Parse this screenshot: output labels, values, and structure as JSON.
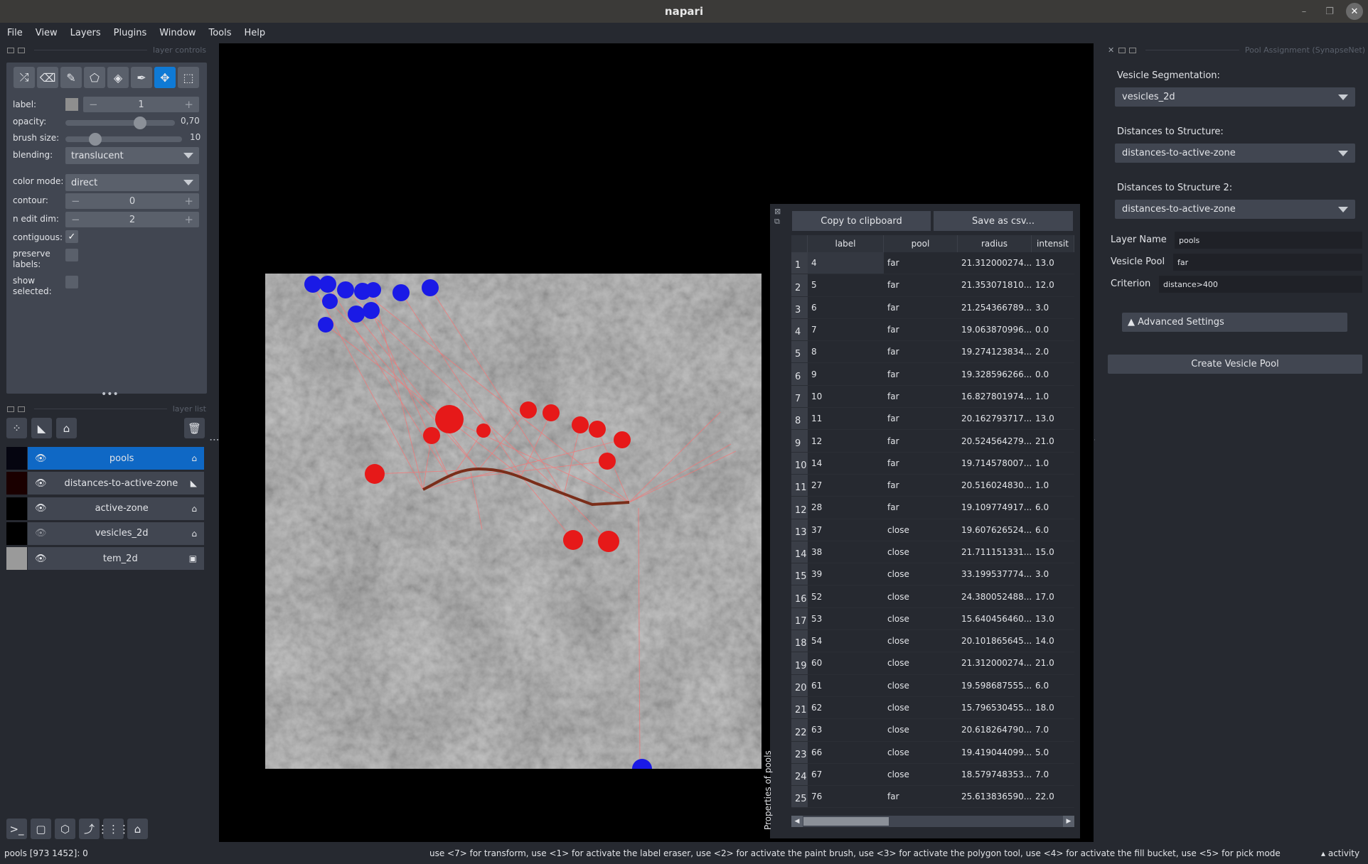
{
  "window": {
    "title": "napari"
  },
  "menu": [
    "File",
    "View",
    "Layers",
    "Plugins",
    "Window",
    "Tools",
    "Help"
  ],
  "layer_controls": {
    "header": "layer controls",
    "tools": [
      "shuffle-colors",
      "erase",
      "paint",
      "polygon",
      "fill",
      "pick",
      "pan-zoom",
      "transform"
    ],
    "active_tool": "pan-zoom",
    "label_label": "label:",
    "label_value": "1",
    "opacity_label": "opacity:",
    "opacity_value": "0,70",
    "opacity_fraction": 0.7,
    "brush_label": "brush size:",
    "brush_value": "10",
    "blending_label": "blending:",
    "blending_value": "translucent",
    "color_mode_label": "color mode:",
    "color_mode_value": "direct",
    "contour_label": "contour:",
    "contour_value": "0",
    "n_edit_label": "n edit dim:",
    "n_edit_value": "2",
    "contiguous_label": "contiguous:",
    "contiguous_checked": true,
    "preserve_label": "preserve labels:",
    "preserve_checked": false,
    "show_selected_label": "show selected:",
    "show_selected_checked": false
  },
  "layer_list": {
    "header": "layer list",
    "layers": [
      {
        "name": "pools",
        "visible": true,
        "type": "labels",
        "selected": true
      },
      {
        "name": "distances-to-active-zone",
        "visible": true,
        "type": "shapes",
        "selected": false
      },
      {
        "name": "active-zone",
        "visible": true,
        "type": "labels",
        "selected": false
      },
      {
        "name": "vesicles_2d",
        "visible": false,
        "type": "labels",
        "selected": false
      },
      {
        "name": "tem_2d",
        "visible": true,
        "type": "image",
        "selected": false
      }
    ]
  },
  "status": {
    "cursor": "pools [973 1452]: 0",
    "help": "use <7> for transform, use <1> for activate the label eraser, use <2> for activate the paint brush, use <3> for activate the polygon tool, use <4> for activate the fill bucket, use <5> for pick mode",
    "activity": "activity"
  },
  "table": {
    "dock_title": "Properties of pools",
    "copy_button": "Copy to clipboard",
    "save_button": "Save as csv...",
    "columns": [
      "label",
      "pool",
      "radius",
      "intensit"
    ],
    "rows": [
      [
        "4",
        "far",
        "21.312000274...",
        "13.0"
      ],
      [
        "5",
        "far",
        "21.353071810...",
        "12.0"
      ],
      [
        "6",
        "far",
        "21.254366789...",
        "3.0"
      ],
      [
        "7",
        "far",
        "19.063870996...",
        "0.0"
      ],
      [
        "8",
        "far",
        "19.274123834...",
        "2.0"
      ],
      [
        "9",
        "far",
        "19.328596266...",
        "0.0"
      ],
      [
        "10",
        "far",
        "16.827801974...",
        "1.0"
      ],
      [
        "11",
        "far",
        "20.162793717...",
        "13.0"
      ],
      [
        "12",
        "far",
        "20.524564279...",
        "21.0"
      ],
      [
        "14",
        "far",
        "19.714578007...",
        "1.0"
      ],
      [
        "27",
        "far",
        "20.516024830...",
        "1.0"
      ],
      [
        "28",
        "far",
        "19.109774917...",
        "6.0"
      ],
      [
        "37",
        "close",
        "19.607626524...",
        "6.0"
      ],
      [
        "38",
        "close",
        "21.711151331...",
        "15.0"
      ],
      [
        "39",
        "close",
        "33.199537774...",
        "3.0"
      ],
      [
        "52",
        "close",
        "24.380052488...",
        "17.0"
      ],
      [
        "53",
        "close",
        "15.640456460...",
        "13.0"
      ],
      [
        "54",
        "close",
        "20.101865645...",
        "14.0"
      ],
      [
        "60",
        "close",
        "21.312000274...",
        "21.0"
      ],
      [
        "61",
        "close",
        "19.598687555...",
        "6.0"
      ],
      [
        "62",
        "close",
        "15.796530455...",
        "18.0"
      ],
      [
        "63",
        "close",
        "20.618264790...",
        "7.0"
      ],
      [
        "66",
        "close",
        "19.419044099...",
        "5.0"
      ],
      [
        "67",
        "close",
        "18.579748353...",
        "7.0"
      ],
      [
        "76",
        "far",
        "25.613836590...",
        "22.0"
      ]
    ]
  },
  "pool_widget": {
    "title": "Pool Assignment (SynapseNet)",
    "seg_label": "Vesicle Segmentation:",
    "seg_value": "vesicles_2d",
    "dist_label": "Distances to Structure:",
    "dist_value": "distances-to-active-zone",
    "dist2_label": "Distances to Structure 2:",
    "dist2_value": "distances-to-active-zone",
    "layer_name_label": "Layer Name",
    "layer_name_value": "pools",
    "pool_label": "Vesicle Pool",
    "pool_value": "far",
    "criterion_label": "Criterion",
    "criterion_value": "distance>400",
    "advanced_label": "▲ Advanced Settings",
    "create_button": "Create Vesicle Pool"
  },
  "colors": {
    "accent": "#0f7ad5",
    "far_vesicle": "#1a1ae6",
    "close_vesicle": "#e61919",
    "active_zone": "#7a2e1a"
  }
}
